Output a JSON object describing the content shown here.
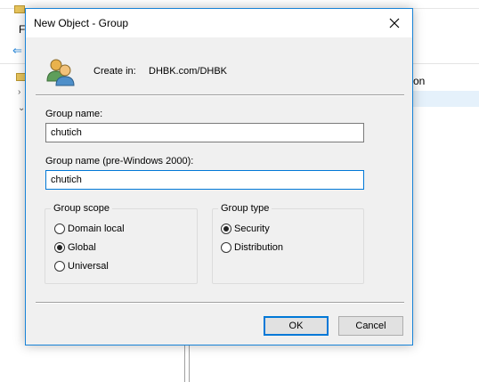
{
  "background": {
    "menu_letter": "F",
    "column_header_fragment": "on"
  },
  "dialog": {
    "title": "New Object - Group",
    "create_in_label": "Create in:",
    "create_in_path": "DHBK.com/DHBK",
    "group_name_label": "Group name:",
    "group_name_value": "chutich",
    "pre2000_label": "Group name (pre-Windows 2000):",
    "pre2000_value": "chutich",
    "scope": {
      "legend": "Group scope",
      "options": [
        "Domain local",
        "Global",
        "Universal"
      ],
      "selected": "Global"
    },
    "type": {
      "legend": "Group type",
      "options": [
        "Security",
        "Distribution"
      ],
      "selected": "Security"
    },
    "ok_label": "OK",
    "cancel_label": "Cancel"
  },
  "icons": {
    "close": "close-icon",
    "group": "group-icon",
    "folder": "folder-icon",
    "back": "back-arrow-icon"
  },
  "colors": {
    "accent": "#0078d7",
    "dialog_border": "#1883d7",
    "dialog_bg": "#f0f0f0"
  }
}
